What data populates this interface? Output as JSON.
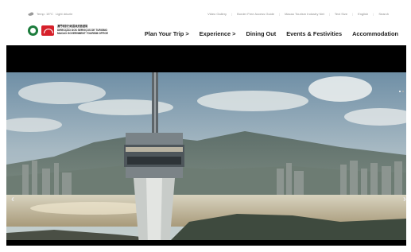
{
  "topbar": {
    "weather_icon": "cloud-icon",
    "weather_temp": "Temp: 15°C",
    "weather_desc": "Light drizzle",
    "links": [
      "Video Gallery",
      "Border Free Access Guide",
      "Macao Tourism Industry Net",
      "Text Size",
      "English",
      "Search"
    ]
  },
  "brand": {
    "line1": "澳門特別行政區政府旅遊局",
    "line2": "DIRECÇÃO DOS SERVIÇOS DE TURISMO",
    "line3": "MACAO GOVERNMENT TOURISM OFFICE",
    "green": "#1c7c3c",
    "red": "#d6202a"
  },
  "nav": {
    "items": [
      "Plan Your Trip >",
      "Experience >",
      "Dining Out",
      "Events & Festivities",
      "Accommodation"
    ]
  },
  "hero": {
    "prev_arrow": "‹",
    "next_arrow": "›",
    "active_slide": 1,
    "slides_count": 2
  }
}
